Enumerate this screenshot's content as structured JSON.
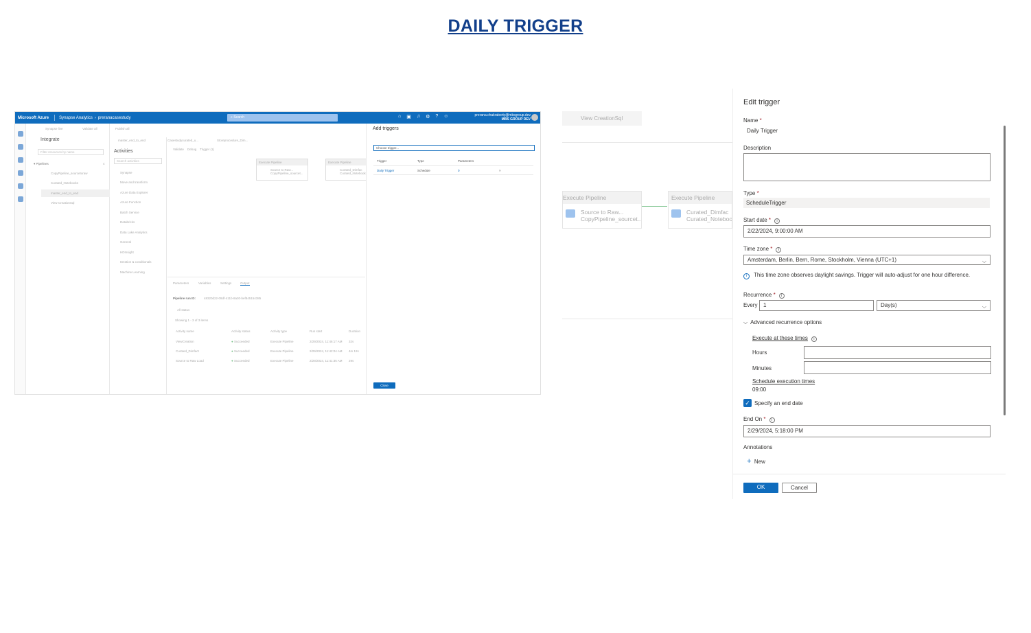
{
  "page_title": "DAILY TRIGGER",
  "left_screenshot": {
    "topbar": {
      "brand": "Microsoft Azure",
      "service": "Synapse Analytics",
      "workspace": "preranacasestudy",
      "search_placeholder": "Search",
      "user_email": "prerana.chakraborty@mbsgroup.dev",
      "user_org": "MBS GROUP DEV"
    },
    "resources": {
      "toolbar_items": [
        "Synapse live",
        "Validate all",
        "Publish all"
      ],
      "title": "Integrate",
      "filter_placeholder": "Filter resources by name",
      "pipelines_label": "Pipelines",
      "pipelines_count": "4",
      "pipelines": [
        "CopyPipeline_sourcetoraw",
        "Curated_Notebooks",
        "master_end_to_end",
        "View CreationSql"
      ]
    },
    "tabs": [
      "master_end_to_end",
      "Casestudycurated_u...",
      "Storeprocedure_Dim..."
    ],
    "activities": {
      "title": "Activities",
      "search_placeholder": "Search activities",
      "items": [
        "Synapse",
        "Move and transform",
        "Azure Data Explorer",
        "Azure Function",
        "Batch Service",
        "Databricks",
        "Data Lake Analytics",
        "General",
        "HDInsight",
        "Iteration & conditionals",
        "Machine Learning"
      ]
    },
    "canvas_toolbar": [
      "Validate",
      "Debug",
      "Trigger (1)"
    ],
    "nodes": [
      {
        "header": "Execute Pipeline",
        "line1": "Source to Raw...",
        "line2": "CopyPipeline_sourcet..."
      },
      {
        "header": "Execute Pipeline",
        "line1": "Curated_Dimfac",
        "line2": "Curated_Notebook"
      }
    ],
    "output": {
      "tabs": [
        "Parameters",
        "Variables",
        "Settings",
        "Output"
      ],
      "run_id_label": "Pipeline run ID:",
      "run_id": "48320d22-09df-411b-8a30-bef845154385",
      "filter": "All status",
      "showing": "Showing 1 - 3 of 3 items",
      "columns": [
        "Activity name",
        "Activity status",
        "Activity type",
        "Run start",
        "Duration"
      ],
      "rows": [
        [
          "ViewCreation",
          "Succeeded",
          "Execute Pipeline",
          "2/29/2024, 11:46:17 AM",
          "32s"
        ],
        [
          "Curated_Dimfact",
          "Succeeded",
          "Execute Pipeline",
          "2/29/2024, 11:42:04 AM",
          "4m 12s"
        ],
        [
          "Source to Raw Load",
          "Succeeded",
          "Execute Pipeline",
          "2/29/2024, 11:41:36 AM",
          "29s"
        ]
      ]
    },
    "add_triggers": {
      "title": "Add triggers",
      "choose_placeholder": "Choose trigger...",
      "columns": [
        "Trigger",
        "Type",
        "Parameters"
      ],
      "row": {
        "trigger": "Daily Trigger",
        "type": "Schedule",
        "parameters": "0"
      },
      "close_label": "Close"
    }
  },
  "right_screenshot": {
    "background": {
      "tab": "View CreationSql",
      "nodes": [
        {
          "header": "Execute Pipeline",
          "line1": "Source to Raw...",
          "line2": "CopyPipeline_sourcet..."
        },
        {
          "header": "Execute Pipeline",
          "line1": "Curated_Dimfac",
          "line2": "Curated_Notebook"
        }
      ]
    },
    "edit_trigger": {
      "title": "Edit trigger",
      "name_label": "Name",
      "name_value": "Daily Trigger",
      "description_label": "Description",
      "description_value": "",
      "type_label": "Type",
      "type_value": "ScheduleTrigger",
      "start_date_label": "Start date",
      "start_date_value": "2/22/2024, 9:00:00 AM",
      "time_zone_label": "Time zone",
      "time_zone_value": "Amsterdam, Berlin, Bern, Rome, Stockholm, Vienna (UTC+1)",
      "dst_note": "This time zone observes daylight savings. Trigger will auto-adjust for one hour difference.",
      "recurrence_label": "Recurrence",
      "every_label": "Every",
      "every_value": "1",
      "every_unit": "Day(s)",
      "advanced_label": "Advanced recurrence options",
      "execute_times_label": "Execute at these times",
      "hours_label": "Hours",
      "hours_value": "",
      "minutes_label": "Minutes",
      "minutes_value": "",
      "schedule_times_label": "Schedule execution times",
      "schedule_times_value": "09:00",
      "specify_end_label": "Specify an end date",
      "specify_end_checked": true,
      "end_on_label": "End On",
      "end_on_value": "2/29/2024, 5:18:00 PM",
      "annotations_label": "Annotations",
      "new_label": "New",
      "ok_label": "OK",
      "cancel_label": "Cancel"
    }
  },
  "colors": {
    "title": "#123f8a",
    "azure_blue": "#0f6cbd",
    "required": "#a4262c"
  }
}
